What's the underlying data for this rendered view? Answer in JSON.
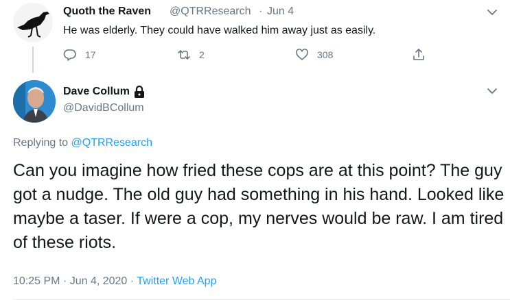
{
  "parent_tweet": {
    "name": "Quoth the Raven",
    "handle": "@QTRResearch",
    "separator": "·",
    "date": "Jun 4",
    "text": "He was elderly. They could have walked him away just as easily.",
    "replies": "17",
    "retweets": "2",
    "likes": "308"
  },
  "main_tweet": {
    "name": "Dave Collum",
    "handle": "@DavidBCollum",
    "replying_prefix": "Replying to ",
    "replying_to": "@QTRResearch",
    "body": "Can you imagine how fried these cops are at this point? The guy got a nudge. The old guy had something in his hand. Looked like maybe a taser. If were a cop, my nerves would be raw. I am tired of these riots.",
    "timestamp": "10:25 PM · Jun 4, 2020 · ",
    "source": "Twitter Web App"
  },
  "icons": {
    "reply": "reply-icon",
    "retweet": "retweet-icon",
    "like": "heart-icon",
    "share": "share-icon",
    "more": "chevron-down-icon",
    "protected": "lock-icon"
  },
  "colors": {
    "accent": "#1da1f2",
    "secondary_text": "#657786",
    "primary_text": "#14171a",
    "divider": "#e6ecf0"
  }
}
